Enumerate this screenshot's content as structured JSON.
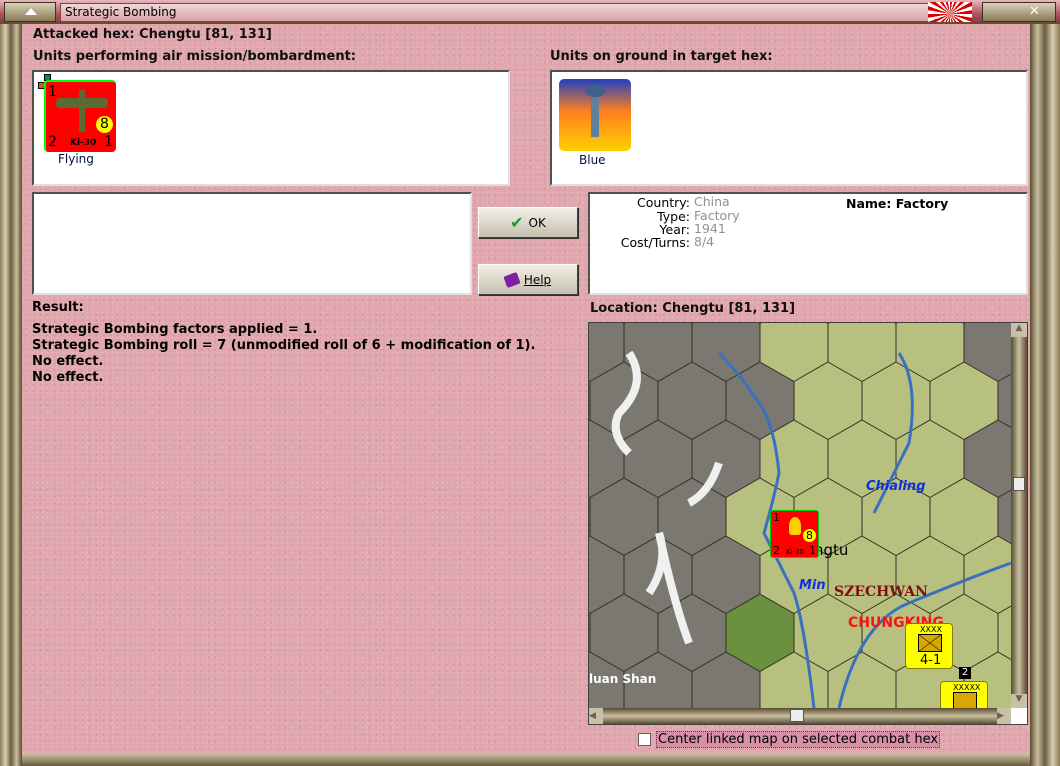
{
  "window": {
    "title": "Strategic Bombing"
  },
  "attacked_hex": "Attacked hex: Chengtu  [81, 131]",
  "air_units_label": "Units performing air mission/bombardment:",
  "ground_units_label": "Units on ground in target hex:",
  "air_units": [
    {
      "name": "Ki-30",
      "status": "Flying",
      "attack": "1",
      "defense": "2",
      "move": "1",
      "range": "8",
      "color": "#ff0000"
    }
  ],
  "ground_units": [
    {
      "name": "Blue",
      "type": "factory"
    }
  ],
  "buttons": {
    "ok": "OK",
    "help": "Help"
  },
  "info": {
    "country_label": "Country:",
    "country": "China",
    "type_label": "Type:",
    "type": "Factory",
    "year_label": "Year:",
    "year": "1941",
    "cost_label": "Cost/Turns:",
    "cost": "8/4",
    "name": "Name: Factory"
  },
  "result": {
    "label": "Result:",
    "lines": [
      "Strategic Bombing factors applied = 1.",
      "Strategic Bombing roll = 7 (unmodified roll of 6 + modification of 1).",
      "No effect.",
      "No effect."
    ]
  },
  "location": "Location:  Chengtu  [81, 131]",
  "map": {
    "labels": {
      "chialing": "Chialing",
      "chengtu": "ngtu",
      "min": "Min",
      "szechwan": "SZECHWAN",
      "chungking": "CHUNGKING",
      "luan_shan": "luan Shan"
    },
    "unit1": {
      "size": "XXXX",
      "value": "4-1"
    },
    "unit2": {
      "size": "XXXXX",
      "stack": "2"
    },
    "counter": {
      "name": "Ki-30",
      "attack": "1",
      "defense": "2",
      "move": "1",
      "range": "8"
    }
  },
  "checkbox": {
    "label": "Center linked map on selected combat hex",
    "checked": false
  },
  "colors": {
    "background": "#e0a8ae",
    "counter_red": "#ff0000",
    "chinese_unit": "#ffff00"
  }
}
